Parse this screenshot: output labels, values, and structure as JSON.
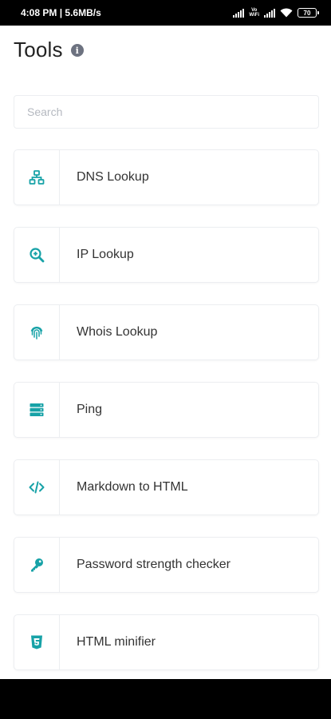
{
  "status_bar": {
    "time": "4:08 PM",
    "speed": "5.6MB/s",
    "volte_top": "Vo",
    "volte_bottom": "WiFi",
    "battery": "70"
  },
  "header": {
    "title": "Tools",
    "info_glyph": "i"
  },
  "search": {
    "placeholder": "Search",
    "value": ""
  },
  "tools": [
    {
      "label": "DNS Lookup",
      "icon": "network-icon"
    },
    {
      "label": "IP Lookup",
      "icon": "search-zoom-icon"
    },
    {
      "label": "Whois Lookup",
      "icon": "fingerprint-icon"
    },
    {
      "label": "Ping",
      "icon": "server-icon"
    },
    {
      "label": "Markdown to HTML",
      "icon": "code-icon"
    },
    {
      "label": "Password strength checker",
      "icon": "key-icon"
    },
    {
      "label": "HTML minifier",
      "icon": "html5-icon"
    }
  ],
  "colors": {
    "accent": "#17a2a7",
    "status_bar_bg": "#000000",
    "card_border": "#eceef1"
  }
}
